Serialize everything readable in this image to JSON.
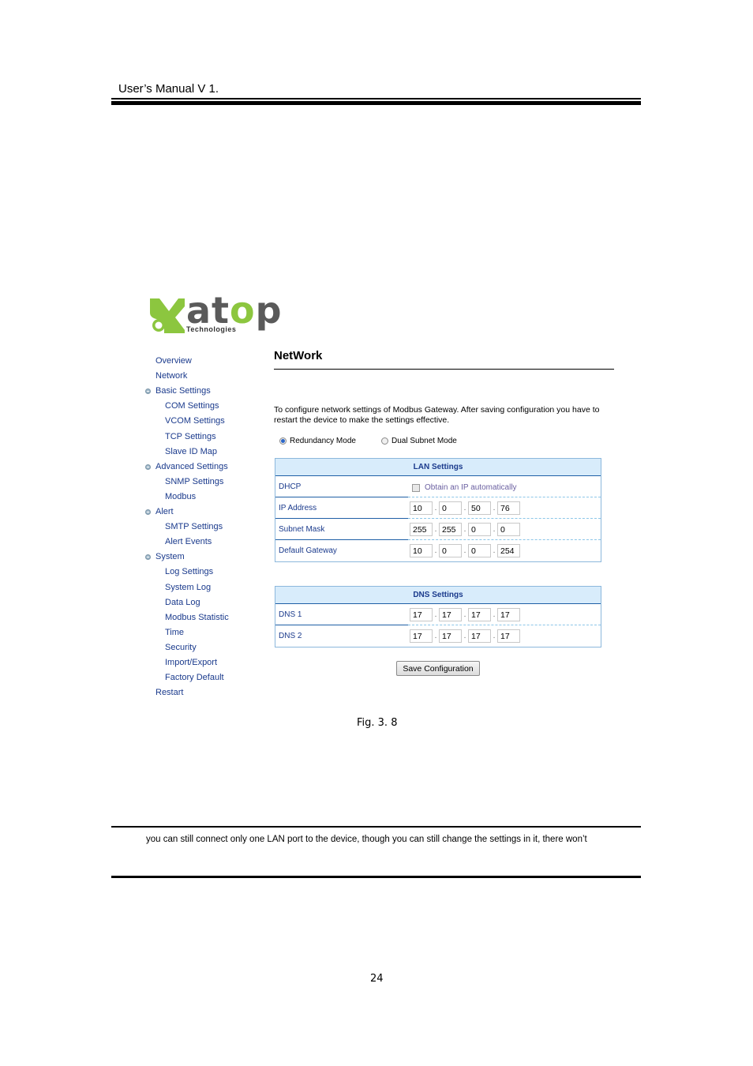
{
  "header": {
    "title": "User’s Manual V 1."
  },
  "logo": {
    "brand_a": "at",
    "brand_o": "o",
    "brand_p": "p",
    "subtitle": "Technologies",
    "green": "#8cc63f",
    "gray": "#5a5a5a"
  },
  "sidebar": {
    "items": [
      {
        "label": "Overview",
        "level": 0,
        "toggle": false
      },
      {
        "label": "Network",
        "level": 0,
        "toggle": false
      },
      {
        "label": "Basic Settings",
        "level": 0,
        "toggle": true
      },
      {
        "label": "COM Settings",
        "level": 1,
        "toggle": false
      },
      {
        "label": "VCOM Settings",
        "level": 1,
        "toggle": false
      },
      {
        "label": "TCP Settings",
        "level": 1,
        "toggle": false
      },
      {
        "label": "Slave ID Map",
        "level": 1,
        "toggle": false
      },
      {
        "label": "Advanced Settings",
        "level": 0,
        "toggle": true
      },
      {
        "label": "SNMP Settings",
        "level": 1,
        "toggle": false
      },
      {
        "label": "Modbus",
        "level": 1,
        "toggle": false
      },
      {
        "label": "Alert",
        "level": 0,
        "toggle": true
      },
      {
        "label": "SMTP Settings",
        "level": 1,
        "toggle": false
      },
      {
        "label": "Alert Events",
        "level": 1,
        "toggle": false
      },
      {
        "label": "System",
        "level": 0,
        "toggle": true
      },
      {
        "label": "Log Settings",
        "level": 1,
        "toggle": false
      },
      {
        "label": "System Log",
        "level": 1,
        "toggle": false
      },
      {
        "label": "Data Log",
        "level": 1,
        "toggle": false
      },
      {
        "label": "Modbus Statistic",
        "level": 1,
        "toggle": false
      },
      {
        "label": "Time",
        "level": 1,
        "toggle": false
      },
      {
        "label": "Security",
        "level": 1,
        "toggle": false
      },
      {
        "label": "Import/Export",
        "level": 1,
        "toggle": false
      },
      {
        "label": "Factory Default",
        "level": 1,
        "toggle": false
      },
      {
        "label": "Restart",
        "level": 0,
        "toggle": false
      }
    ]
  },
  "main": {
    "title": "NetWork",
    "description": "To configure network settings of Modbus Gateway. After saving configuration you have to restart the device to make the settings effective.",
    "modes": [
      {
        "label": "Redundancy Mode",
        "checked": true
      },
      {
        "label": "Dual Subnet Mode",
        "checked": false
      }
    ],
    "lan": {
      "heading": "LAN Settings",
      "dhcp_label": "DHCP",
      "dhcp_checkbox_label": "Obtain an IP automatically",
      "dhcp_checked": false,
      "rows": [
        {
          "label": "IP Address",
          "octets": [
            "10",
            "0",
            "50",
            "76"
          ]
        },
        {
          "label": "Subnet Mask",
          "octets": [
            "255",
            "255",
            "0",
            "0"
          ]
        },
        {
          "label": "Default Gateway",
          "octets": [
            "10",
            "0",
            "0",
            "254"
          ]
        }
      ]
    },
    "dns": {
      "heading": "DNS Settings",
      "rows": [
        {
          "label": "DNS 1",
          "octets": [
            "17",
            "17",
            "17",
            "17"
          ]
        },
        {
          "label": "DNS 2",
          "octets": [
            "17",
            "17",
            "17",
            "17"
          ]
        }
      ]
    },
    "save_label": "Save Configuration"
  },
  "caption": "Fig. 3. 8",
  "body_text": "you can still connect only one LAN port to the device, though you can still change the settings in it, there won’t",
  "page_number": "24"
}
